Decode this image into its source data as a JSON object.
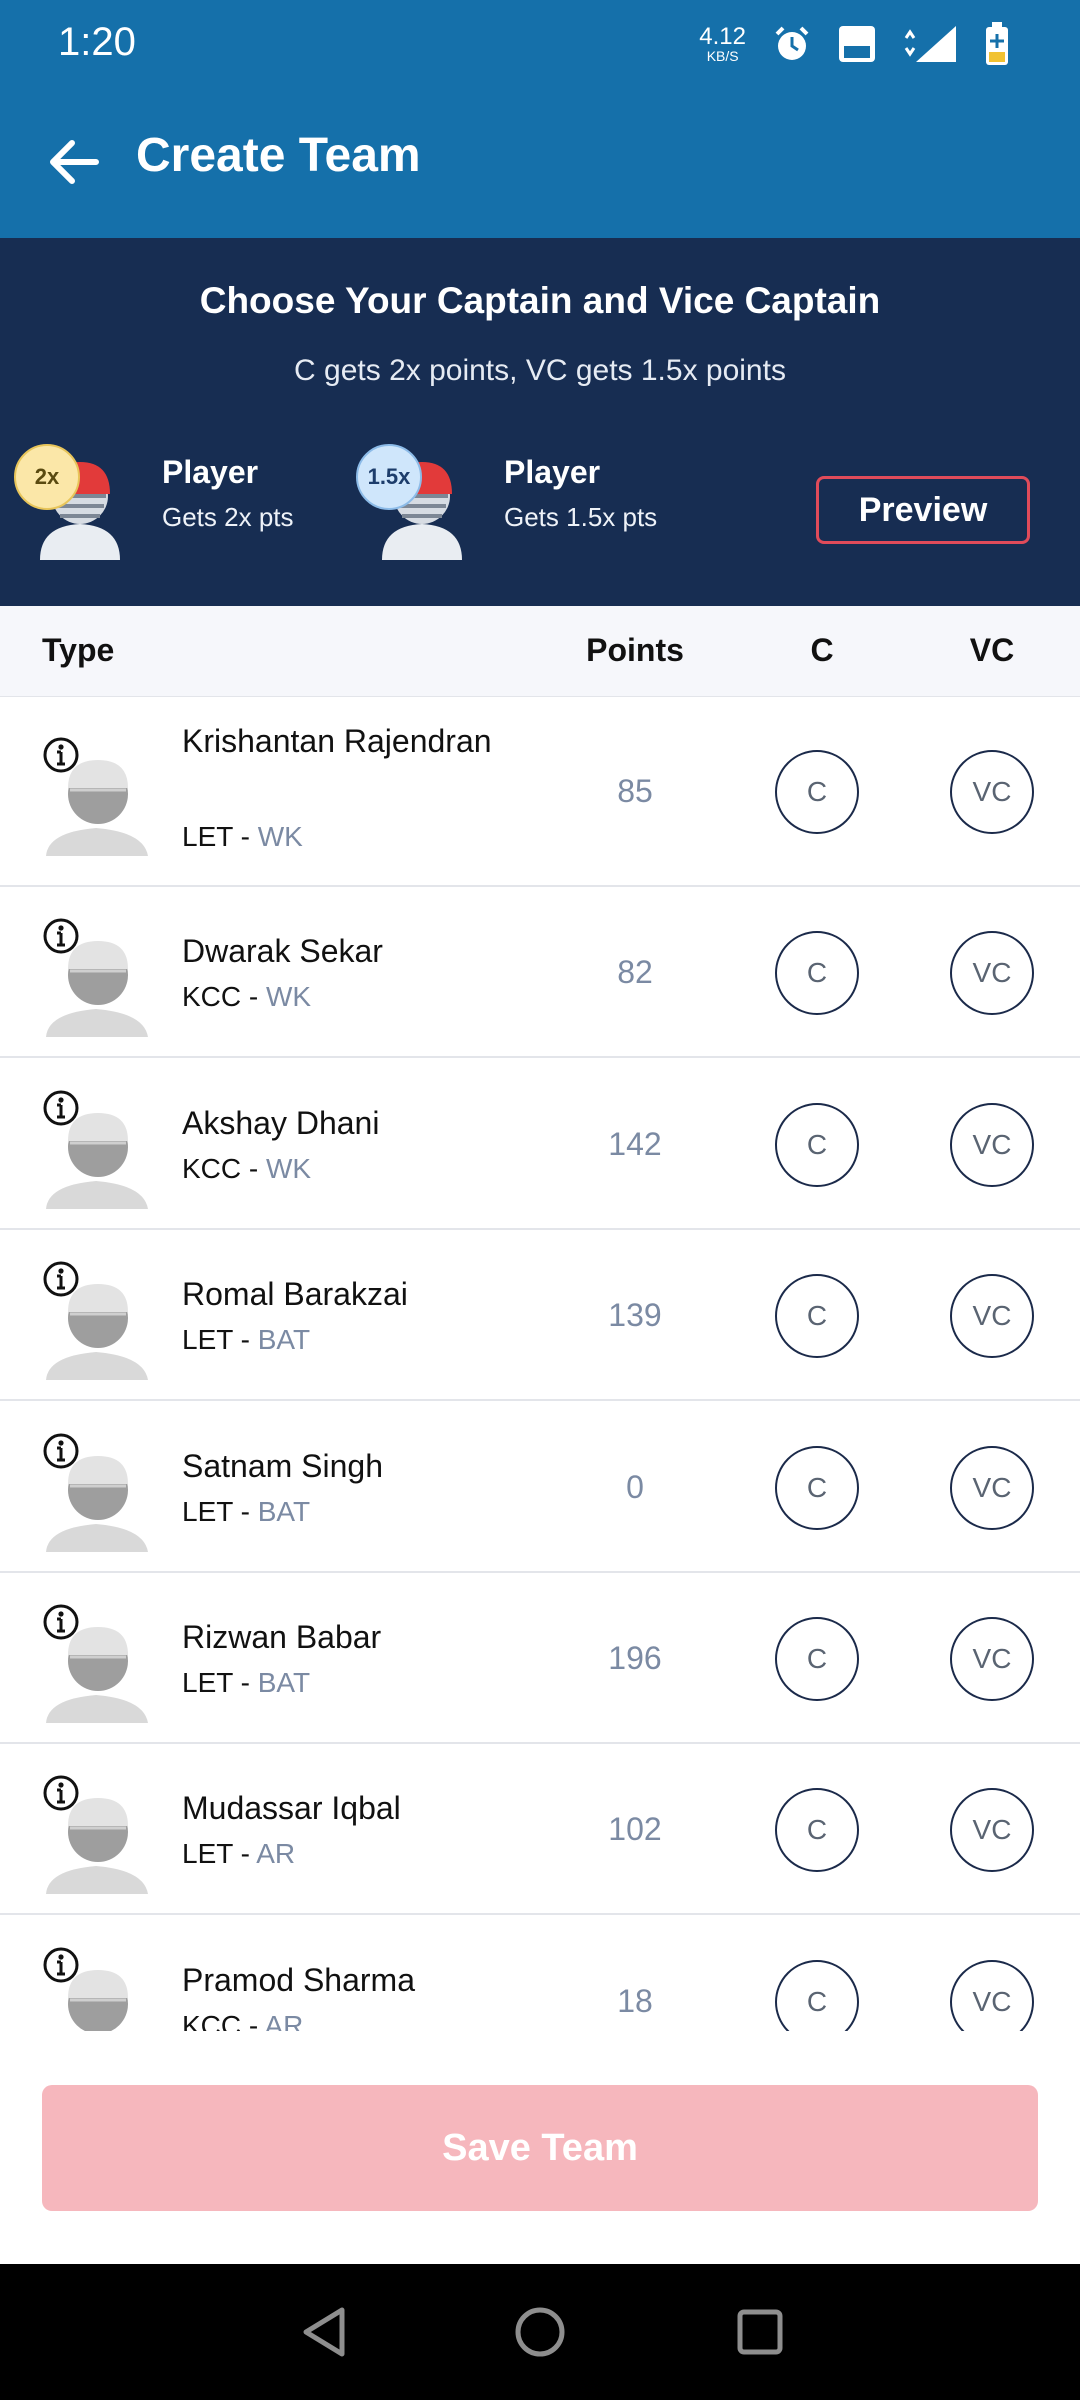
{
  "status": {
    "time": "1:20",
    "net_speed_value": "4.12",
    "net_speed_unit": "KB/S",
    "icons": [
      "alarm-icon",
      "volte-icon",
      "4g-signal-icon",
      "battery-charging-icon"
    ]
  },
  "appbar": {
    "title": "Create Team"
  },
  "hero": {
    "title": "Choose Your Captain and Vice Captain",
    "subtitle": "C gets 2x points, VC gets 1.5x points",
    "captain": {
      "badge": "2x",
      "label": "Player",
      "desc": "Gets 2x pts"
    },
    "vice_captain": {
      "badge": "1.5x",
      "label": "Player",
      "desc": "Gets 1.5x pts"
    },
    "preview_label": "Preview"
  },
  "table": {
    "headers": {
      "type": "Type",
      "points": "Points",
      "c": "C",
      "vc": "VC"
    },
    "c_label": "C",
    "vc_label": "VC"
  },
  "players": [
    {
      "name": "Krishantan Rajendran",
      "team": "LET - ",
      "role": "WK",
      "points": "85"
    },
    {
      "name": "Dwarak Sekar",
      "team": "KCC - ",
      "role": "WK",
      "points": "82"
    },
    {
      "name": "Akshay Dhani",
      "team": "KCC - ",
      "role": "WK",
      "points": "142"
    },
    {
      "name": "Romal Barakzai",
      "team": "LET - ",
      "role": "BAT",
      "points": "139"
    },
    {
      "name": "Satnam Singh",
      "team": "LET - ",
      "role": "BAT",
      "points": "0"
    },
    {
      "name": "Rizwan Babar",
      "team": "LET - ",
      "role": "BAT",
      "points": "196"
    },
    {
      "name": "Mudassar Iqbal",
      "team": "LET - ",
      "role": "AR",
      "points": "102"
    },
    {
      "name": "Pramod Sharma",
      "team": "KCC - ",
      "role": "AR",
      "points": "18"
    }
  ],
  "footer": {
    "save_label": "Save Team"
  },
  "colors": {
    "primary": "#1570aa",
    "hero_bg": "#172d52",
    "accent_red": "#e04b5a",
    "save_disabled": "#f6b7bd",
    "muted_text": "#7b8aa3"
  }
}
